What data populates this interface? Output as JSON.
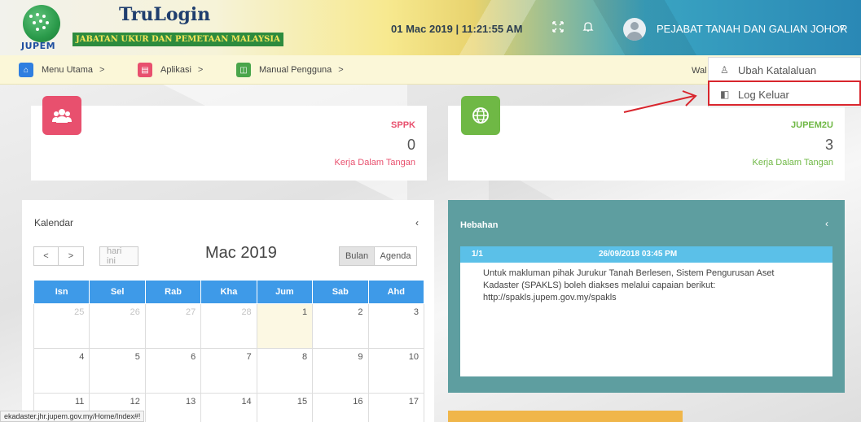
{
  "header": {
    "logo_text": "JUPEM",
    "brand_title": "TruLogin",
    "brand_subtitle": "JABATAN UKUR DAN PEMETAAN MALAYSIA",
    "datetime": "01 Mac 2019 | 11:21:55 AM",
    "fullscreen_icon": "expand-icon",
    "bell_icon": "bell-icon",
    "user_name": "PEJABAT TANAH DAN GALIAN JOHOR",
    "caret": "˅"
  },
  "breadcrumb": {
    "items": [
      {
        "label": "Menu Utama",
        "icon": "home-icon",
        "color": "#2f7fe0",
        "glyph": "⌂"
      },
      {
        "label": "Aplikasi",
        "icon": "app-icon",
        "color": "#e8506e",
        "glyph": "▤"
      },
      {
        "label": "Manual Pengguna",
        "icon": "book-icon",
        "color": "#4aa54a",
        "glyph": "◫"
      }
    ],
    "separator": ">",
    "welcome_partial": "Wal"
  },
  "user_menu": {
    "items": [
      {
        "label": "Ubah Katalaluan",
        "icon": "user-icon",
        "glyph": "♙"
      },
      {
        "label": "Log Keluar",
        "icon": "logout-icon",
        "glyph": "◧"
      }
    ]
  },
  "stats": [
    {
      "title": "SPPK",
      "count": "0",
      "sub": "Kerja Dalam Tangan",
      "color": "#e8506e",
      "icon": "users-icon",
      "glyph": "👥"
    },
    {
      "title": "JUPEM2U",
      "count": "3",
      "sub": "Kerja Dalam Tangan",
      "color": "#6fb845",
      "icon": "globe-icon",
      "glyph": "🌐"
    }
  ],
  "calendar": {
    "title": "Kalendar",
    "caret": "‹",
    "prev": "<",
    "next": ">",
    "today": "hari ini",
    "month_label": "Mac 2019",
    "view_month": "Bulan",
    "view_agenda": "Agenda",
    "days": [
      "Isn",
      "Sel",
      "Rab",
      "Kha",
      "Jum",
      "Sab",
      "Ahd"
    ],
    "weeks": [
      [
        "25",
        "26",
        "27",
        "28",
        "1",
        "2",
        "3"
      ],
      [
        "4",
        "5",
        "6",
        "7",
        "8",
        "9",
        "10"
      ],
      [
        "11",
        "12",
        "13",
        "14",
        "15",
        "16",
        "17"
      ]
    ]
  },
  "hebahan": {
    "title": "Hebahan",
    "caret": "‹",
    "index": "1/1",
    "date": "26/09/2018 03:45 PM",
    "line1": "Untuk makluman pihak Jurukur Tanah Berlesen, Sistem Pengurusan Aset",
    "line2": "Kadaster (SPAKLS) boleh diakses melalui capaian berikut:",
    "line3": "http://spakls.jupem.gov.my/spakls"
  },
  "status_url": "ekadaster.jhr.jupem.gov.my/Home/Index#!"
}
